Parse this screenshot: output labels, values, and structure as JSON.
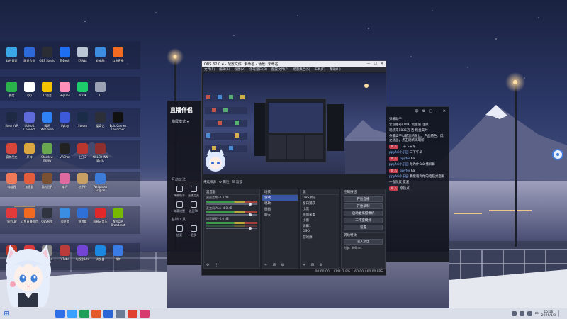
{
  "desktop": {
    "rows": [
      [
        {
          "label": "软件管家",
          "color": "#3aa7e6"
        },
        {
          "label": "腾讯会议",
          "color": "#2d69d8"
        },
        {
          "label": "OBS Studio",
          "color": "#2b2d35"
        },
        {
          "label": "ToDesk",
          "color": "#1d6ef0"
        },
        {
          "label": "回收站",
          "color": "#b9c6d6"
        },
        {
          "label": "此电脑",
          "color": "#3d8ee0"
        },
        {
          "label": "斗鱼直播",
          "color": "#f36b21"
        }
      ],
      [
        {
          "label": "微信",
          "color": "#2bb24c"
        },
        {
          "label": "QQ",
          "color": "#ffffff"
        },
        {
          "label": "YY语音",
          "color": "#f5c400"
        },
        {
          "label": "PopUse",
          "color": "#ff8fb8"
        },
        {
          "label": "KOOK",
          "color": "#1fcc6a"
        },
        {
          "label": "G",
          "color": "#9aa2b3"
        }
      ],
      [
        {
          "label": "SteamVR",
          "color": "#1e2a44"
        },
        {
          "label": "Ubisoft Connect",
          "color": "#5e6bd8"
        },
        {
          "label": "腾讯WeGame",
          "color": "#2f82f5"
        },
        {
          "label": "Uplay",
          "color": "#3d5ad8"
        },
        {
          "label": "Steam",
          "color": "#1b2c49"
        },
        {
          "label": "爱奇艺",
          "color": "#2c2f38"
        },
        {
          "label": "Epic Games Launcher",
          "color": "#111111"
        }
      ],
      [
        {
          "label": "赛博朋克",
          "color": "#d8453b"
        },
        {
          "label": "原神",
          "color": "#d9a640"
        },
        {
          "label": "Stardew Valley",
          "color": "#6aa84f"
        },
        {
          "label": "VRChat",
          "color": "#222222"
        },
        {
          "label": "仁王2",
          "color": "#b8362e"
        },
        {
          "label": "KILLER INN BETA",
          "color": "#8e2f2f"
        }
      ],
      [
        {
          "label": "喵喵云",
          "color": "#ef7a5a"
        },
        {
          "label": "加速器",
          "color": "#e35c3c"
        },
        {
          "label": "我的世界",
          "color": "#7a5233"
        },
        {
          "label": "崩坏",
          "color": "#df6aa0"
        },
        {
          "label": "地平线",
          "color": "#c9a063"
        },
        {
          "label": "Wallpaper Engine",
          "color": "#3c7bd7"
        }
      ],
      [
        {
          "label": "全民K歌",
          "color": "#e23a3a"
        },
        {
          "label": "斗鱼直播伴侣",
          "color": "#f26a1f"
        },
        {
          "label": "OBS预览",
          "color": "#303440"
        },
        {
          "label": "米哈游",
          "color": "#3a8de0"
        },
        {
          "label": "快剪辑",
          "color": "#2f6fd8"
        },
        {
          "label": "网易云音乐",
          "color": "#e0282a"
        },
        {
          "label": "NVIDIA Broadcast",
          "color": "#76b900"
        }
      ],
      [
        {
          "label": "Audio",
          "color": "#c0392b"
        },
        {
          "label": "网易邮箱",
          "color": "#d93b3b"
        },
        {
          "label": "HoloMe",
          "color": "#888888"
        },
        {
          "label": "VTube",
          "color": "#bb3a3a"
        },
        {
          "label": "电视剧Lite",
          "color": "#7445d4"
        },
        {
          "label": "浏览器",
          "color": "#1c87e0"
        },
        {
          "label": "微博",
          "color": "#3a7be6"
        }
      ]
    ]
  },
  "live_app": {
    "logo": "直播伴侣",
    "mode": "横屏模式 ▾",
    "section_interact": "互动玩法",
    "section_tools": "基础工具",
    "tools": [
      {
        "label": "弹幕助手"
      },
      {
        "label": "直播工具"
      },
      {
        "label": "弹幕设置"
      },
      {
        "label": "连麦PK"
      },
      {
        "label": "抽奖"
      },
      {
        "label": "更多"
      }
    ]
  },
  "obs": {
    "title": "OBS 32.0.4 - 配置文件: 未命名 - 场景: 未命名",
    "window_controls": [
      "—",
      "☐",
      "✕"
    ],
    "menu": [
      "文件(F)",
      "编辑(E)",
      "视图(V)",
      "停靠窗口(D)",
      "配置文件(P)",
      "场景集合(S)",
      "工具(T)",
      "帮助(H)"
    ],
    "status_left": "未选择源",
    "status_props": "⚙ 属性",
    "status_filter": "☰ 滤镜",
    "docks": {
      "mixer": {
        "title": "混音器",
        "channels": [
          {
            "name": "桌面音频",
            "level": "-7.3 dB"
          },
          {
            "name": "麦克风/Aux",
            "level": "-4.8 dB"
          },
          {
            "name": "语音聊天",
            "level": "-0.0 dB"
          }
        ]
      },
      "scenes": {
        "title": "场景",
        "items": [
          "游戏",
          "唱歌",
          "画画",
          "聊天"
        ],
        "selected": 0
      },
      "sources": {
        "title": "源",
        "items": [
          "OBS预览",
          "窗口捕获",
          "小黑",
          "画面采集",
          "小窗",
          "弹幕1",
          "OSO",
          "游戏源"
        ]
      },
      "controls": {
        "title": "控制按钮",
        "buttons": [
          "开始直播",
          "开始录制",
          "启动虚拟摄像机",
          "工作室模式",
          "设置",
          "退出"
        ]
      },
      "transitions": {
        "title": "转场特效",
        "type": "淡入淡出",
        "duration_label": "时长",
        "duration": "300 ms"
      }
    },
    "statusbar": {
      "cpu": "CPU: 1.8%",
      "fps": "60.00 / 60.00 FPS",
      "time": "00:00:00"
    }
  },
  "chat": {
    "controls": [
      "☺",
      "⚙",
      "□",
      "—",
      "✕"
    ],
    "header": "弹幕助手",
    "messages": [
      {
        "badge": "",
        "user": "",
        "text": "云现拍号(109)  流量值  活跃"
      },
      {
        "badge": "",
        "user": "",
        "text": "现场来1835万 活 粉丝实时"
      },
      {
        "badge": "",
        "user": "",
        "text": "条最高于以前流的粉丝。产品特色：风之动画，点击刷新再刷新"
      },
      {
        "badge": "大 八",
        "user": "",
        "text": "二十下午早"
      },
      {
        "badge": "",
        "user": "ppyfei小乐园",
        "text": "二下午早"
      },
      {
        "badge": "大 八",
        "user": "ppyfei",
        "text": "ha"
      },
      {
        "badge": "",
        "user": "ppyfei小乐园",
        "text": "你为什么么播屏幕"
      },
      {
        "badge": "大 八",
        "user": "ppyfei",
        "text": "ha"
      },
      {
        "badge": "",
        "user": "ppyfei小乐园",
        "text": "我能看到你的电脑桌面呢"
      },
      {
        "badge": "",
        "user": "",
        "text": "一会队友 友爱"
      },
      {
        "badge": "大 八",
        "user": "",
        "text": "亲热点"
      }
    ]
  },
  "taskbar": {
    "start": "⊞",
    "apps": [
      "#2f6fe8",
      "#3aa0ff",
      "#1fa05a",
      "#e35b2b",
      "#2b66d6",
      "#6b7a95",
      "#e0402f",
      "#d63a6e"
    ],
    "clock_time": "15:16",
    "clock_date": "2026/1/8",
    "tray_text": "中"
  }
}
